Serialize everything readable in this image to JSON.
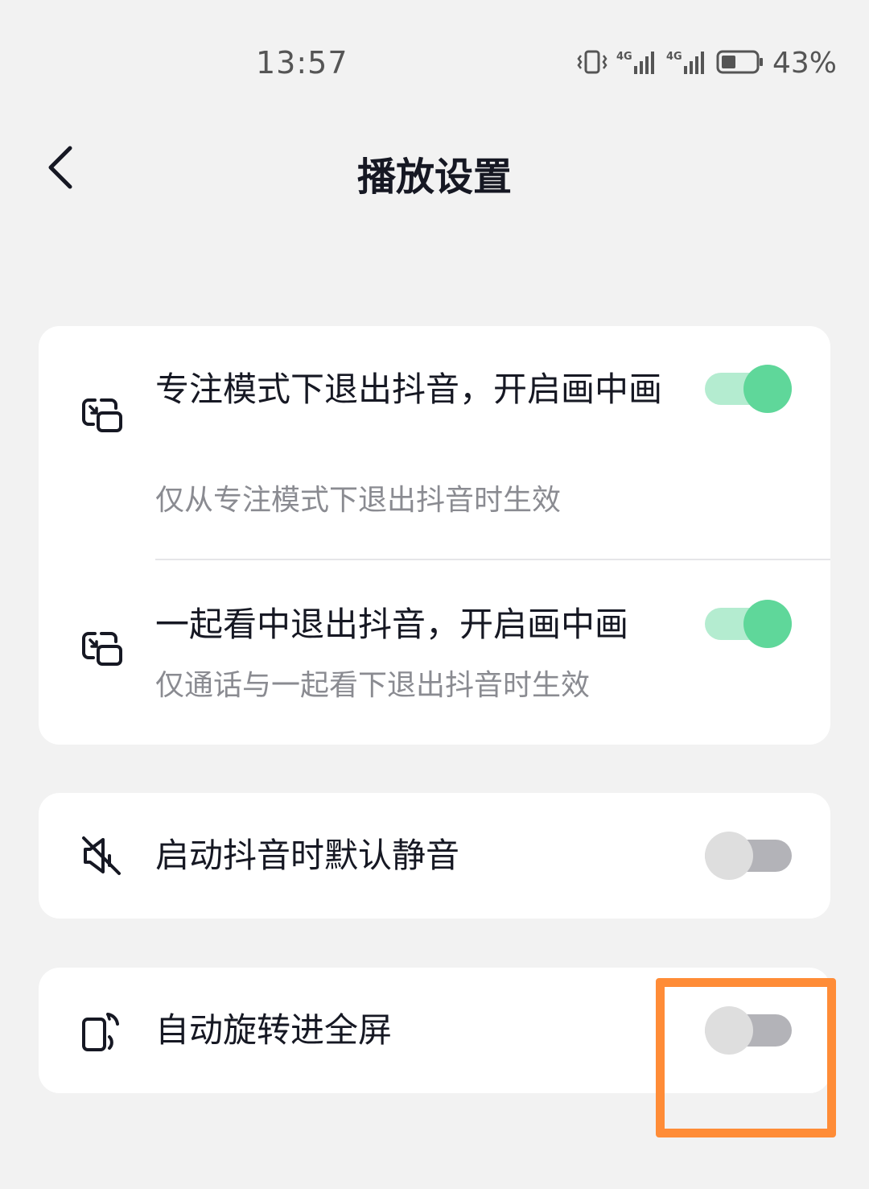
{
  "status_bar": {
    "time": "13:57",
    "battery_percent": "43%",
    "battery_level": 0.43,
    "network_1": "4G",
    "network_2": "4G",
    "icons": [
      "vibrate-icon",
      "signal-4g-icon",
      "signal-4g-icon",
      "battery-icon"
    ]
  },
  "header": {
    "back_icon": "chevron-left-icon",
    "title": "播放设置"
  },
  "settings": {
    "group1": [
      {
        "icon": "picture-in-picture-icon",
        "title": "专注模式下退出抖音，开启画中画",
        "subtitle": "仅从专注模式下退出抖音时生效",
        "enabled": true
      },
      {
        "icon": "picture-in-picture-icon",
        "title": "一起看中退出抖音，开启画中画",
        "subtitle": "仅通话与一起看下退出抖音时生效",
        "enabled": true
      }
    ],
    "group2": [
      {
        "icon": "mute-speaker-icon",
        "title": "启动抖音时默认静音",
        "enabled": false
      }
    ],
    "group3": [
      {
        "icon": "rotate-screen-icon",
        "title": "自动旋转进全屏",
        "enabled": false
      }
    ]
  },
  "colors": {
    "background": "#f2f2f2",
    "card": "#ffffff",
    "toggle_on_knob": "#5fd79a",
    "toggle_on_track": "#b4ecd0",
    "toggle_off_knob": "#dedede",
    "toggle_off_track": "#b3b3b8",
    "highlight": "#ff8c37"
  }
}
